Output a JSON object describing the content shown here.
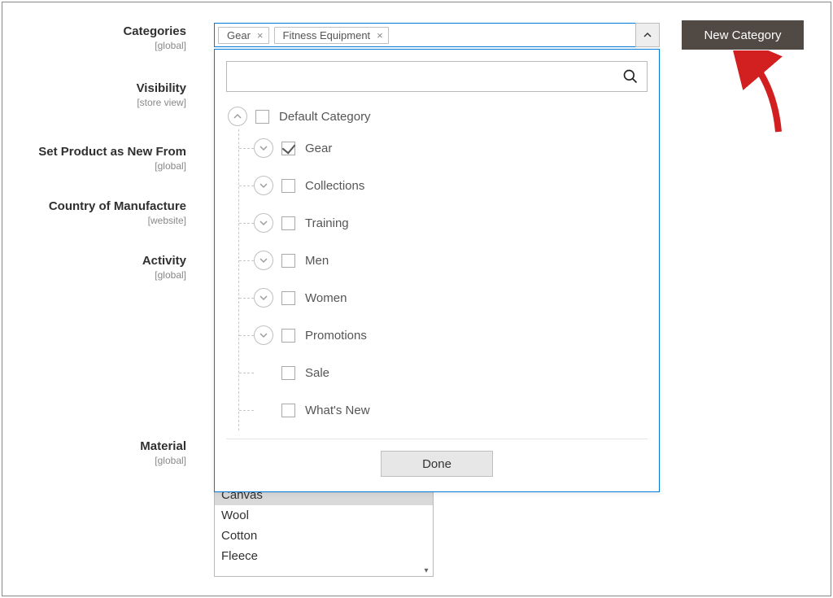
{
  "labels": {
    "categories": {
      "text": "Categories",
      "scope": "[global]"
    },
    "visibility": {
      "text": "Visibility",
      "scope": "[store view]"
    },
    "new_from": {
      "text": "Set Product as New From",
      "scope": "[global]"
    },
    "country": {
      "text": "Country of Manufacture",
      "scope": "[website]"
    },
    "activity": {
      "text": "Activity",
      "scope": "[global]"
    },
    "material": {
      "text": "Material",
      "scope": "[global]"
    }
  },
  "tags": {
    "gear": "Gear",
    "fitness": "Fitness Equipment"
  },
  "new_category_btn": "New Category",
  "tree": {
    "root": "Default Category",
    "children": {
      "gear": "Gear",
      "collections": "Collections",
      "training": "Training",
      "men": "Men",
      "women": "Women",
      "promotions": "Promotions",
      "sale": "Sale",
      "whatsnew": "What's New"
    }
  },
  "done_btn": "Done",
  "material_options": {
    "canvas": "Canvas",
    "wool": "Wool",
    "cotton": "Cotton",
    "fleece": "Fleece"
  }
}
